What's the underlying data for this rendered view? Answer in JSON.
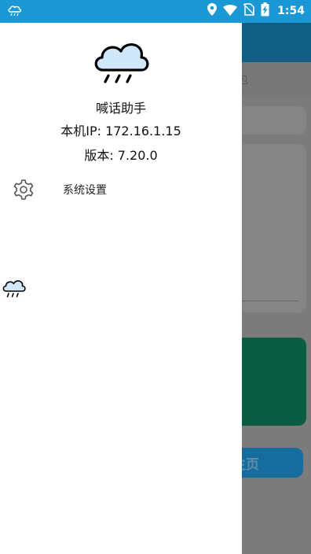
{
  "status_bar": {
    "time": "1:54",
    "icons": [
      "rain-cloud-icon",
      "location-icon",
      "wifi-icon",
      "no-sim-icon",
      "battery-charging-icon"
    ]
  },
  "drawer": {
    "app_name": "喊话助手",
    "ip_text": "本机IP: 172.16.1.15",
    "version_text": "版本: 7.20.0",
    "menu": [
      {
        "icon": "gear-icon",
        "label": "系统设置"
      }
    ]
  },
  "background": {
    "tab_label_fragment": "包",
    "home_button_fragment": "主页"
  },
  "colors": {
    "status_bar": "#1a98d6",
    "app_bar": "#115e84",
    "green_panel": "#0a5c43",
    "home_button": "#156c9d",
    "drawer": "#ffffff"
  }
}
